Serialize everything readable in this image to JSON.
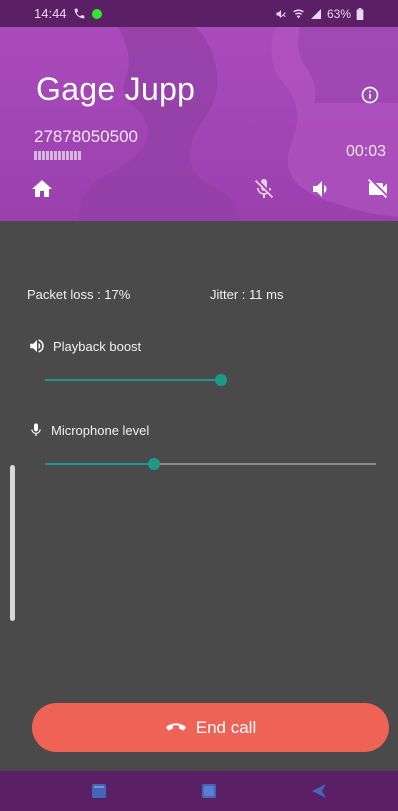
{
  "status_bar": {
    "time": "14:44",
    "battery": "63%"
  },
  "call": {
    "caller_name": "Gage Jupp",
    "caller_number": "27878050500",
    "duration": "00:03"
  },
  "stats": {
    "packet_loss": "Packet loss : 17%",
    "jitter": "Jitter : 11 ms"
  },
  "playback": {
    "label": "Playback boost",
    "level": 0.5
  },
  "microphone": {
    "label": "Microphone level",
    "level": 0.33
  },
  "end_call": {
    "label": "End call"
  },
  "colors": {
    "header": "#a94bbb",
    "status_bar": "#5a1f64",
    "background": "#4a4a4a",
    "accent": "#1d9a86",
    "end_call": "#ee6356"
  },
  "icons": {
    "status": [
      "phone-icon",
      "green-dot",
      "mute-icon",
      "wifi-icon",
      "signal-icon",
      "battery-icon"
    ],
    "header": [
      "home-icon",
      "mic-off-icon",
      "speaker-icon",
      "video-off-icon",
      "info-icon"
    ],
    "nav": [
      "recent-apps-icon",
      "home-nav-icon",
      "back-icon"
    ]
  }
}
